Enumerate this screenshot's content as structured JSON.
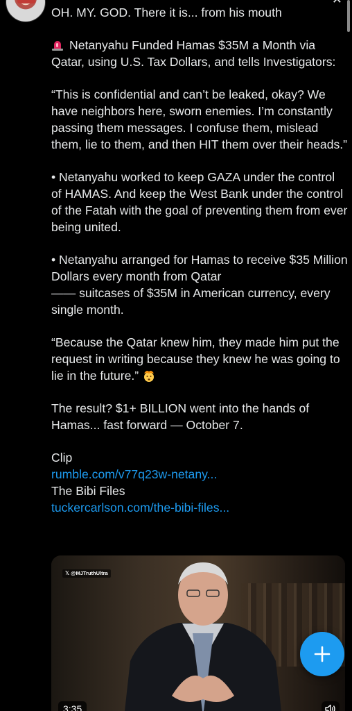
{
  "tweet": {
    "line_intro": "OH. MY. GOD. There it is... from his mouth",
    "headline": "Netanyahu Funded Hamas $35M a Month via Qatar, using U.S. Tax Dollars, and tells Investigators:",
    "quote1": "“This is confidential and can’t be leaked, okay? We have neighbors here, sworn enemies. I’m constantly passing them messages. I confuse them, mislead them, lie to them, and then HIT them over their heads.”",
    "bullet1": "• Netanyahu worked to keep GAZA under the control of  HAMAS. And keep the West Bank under the control of the Fatah with the goal of preventing them from ever being united.",
    "bullet2_line1": "• Netanyahu arranged for Hamas to receive $35 Million Dollars every month from Qatar",
    "bullet2_line2": "—— suitcases of $35M in American currency, every single month.",
    "quote2": "“Because the Qatar knew him, they made him put the request in writing because they knew he was going to lie in the future.”",
    "result": "The result? $1+ BILLION went into the hands of Hamas... fast forward — October 7.",
    "clip_label": "Clip",
    "clip_link": "rumble.com/v77q23w-netany...",
    "files_label": "The Bibi Files",
    "files_link": "tuckercarlson.com/the-bibi-files..."
  },
  "video": {
    "watermark": "@MJTruthUltra",
    "duration": "3:35"
  },
  "icons": {
    "siren": "police-light-emoji",
    "face": "exploding-head-emoji",
    "volume": "speaker-icon",
    "fab": "plus-icon"
  },
  "colors": {
    "link": "#1d9bf0",
    "fab": "#1d9bf0",
    "background": "#000000",
    "text": "#e7e9ea"
  }
}
